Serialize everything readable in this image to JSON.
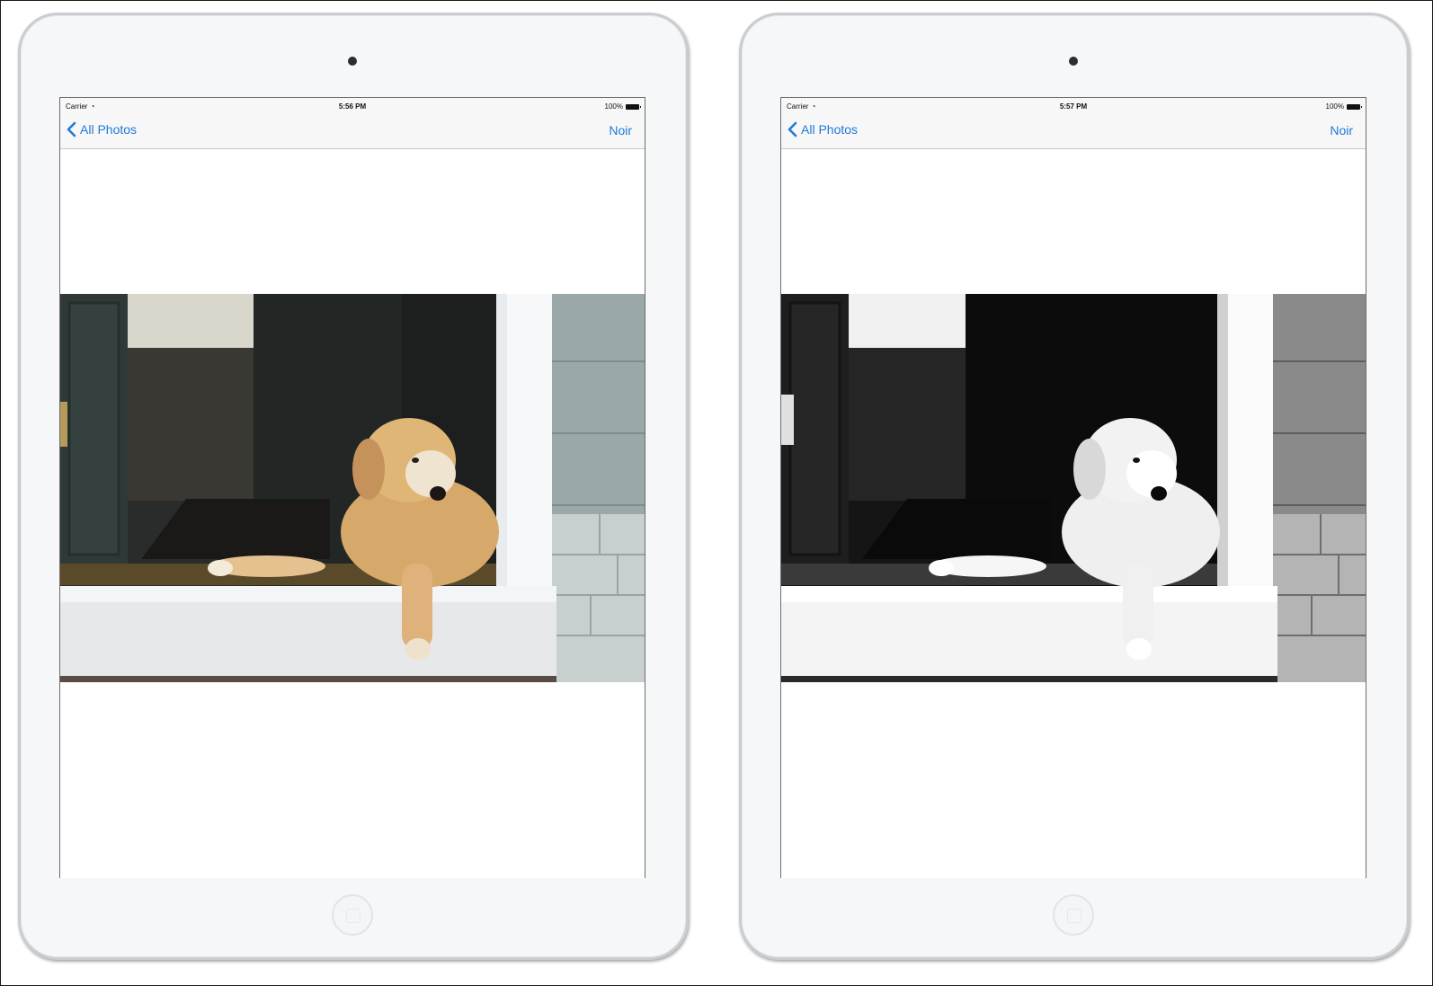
{
  "devices": [
    {
      "status": {
        "carrier": "Carrier",
        "time": "5:56 PM",
        "battery": "100%"
      },
      "nav": {
        "back_label": "All Photos",
        "action_label": "Noir"
      },
      "photo": {
        "filter": "none"
      }
    },
    {
      "status": {
        "carrier": "Carrier",
        "time": "5:57 PM",
        "battery": "100%"
      },
      "nav": {
        "back_label": "All Photos",
        "action_label": "Noir"
      },
      "photo": {
        "filter": "noir"
      }
    }
  ],
  "colors": {
    "tint": "#1f7ad8",
    "bar_background": "#f7f7f7",
    "device_body": "#f5f7f8"
  },
  "icons": {
    "back": "chevron-left-icon",
    "wifi": "wifi-icon",
    "battery": "battery-icon"
  }
}
